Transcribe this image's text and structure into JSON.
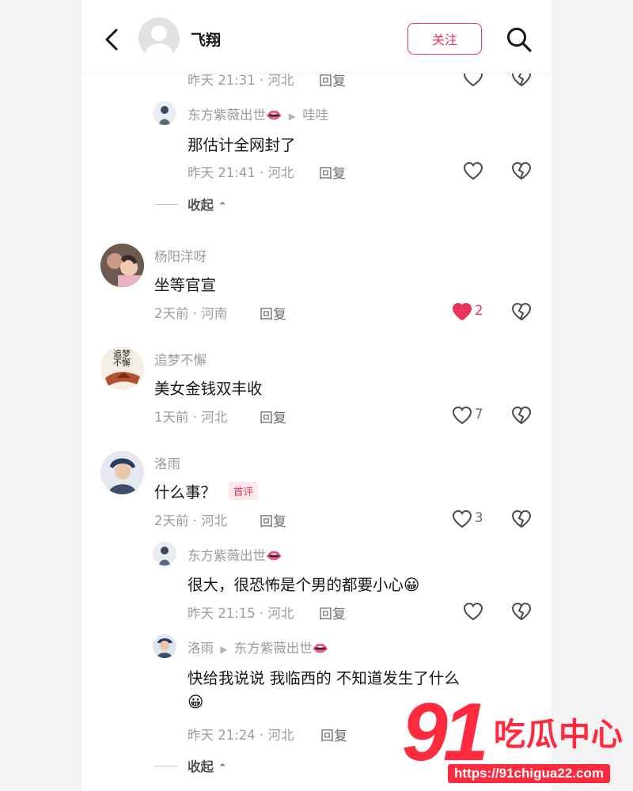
{
  "header": {
    "username": "飞翔",
    "follow_label": "关注"
  },
  "top_reply": {
    "meta": "昨天 21:31 · 河北",
    "reply_label": "回复"
  },
  "reply_a": {
    "author": "东方紫薇出世👄",
    "target": "哇哇",
    "text": "那估计全网封了",
    "meta": "昨天 21:41 · 河北",
    "reply_label": "回复"
  },
  "collapse_label": "收起",
  "comments": [
    {
      "author": "杨阳洋呀",
      "text": "坐等官宣",
      "meta": "2天前 · 河南",
      "reply_label": "回复",
      "likes": "2",
      "liked": true
    },
    {
      "author": "追梦不懈",
      "avatar_text": "追梦不懈",
      "text": "美女金钱双丰收",
      "meta": "1天前 · 河北",
      "reply_label": "回复",
      "likes": "7",
      "liked": false
    },
    {
      "author": "洛雨",
      "text": "什么事？",
      "badge": "首评",
      "meta": "2天前 · 河北",
      "reply_label": "回复",
      "likes": "3",
      "liked": false
    }
  ],
  "replies": [
    {
      "author": "东方紫薇出世👄",
      "text": "很大，很恐怖是个男的都要小心😀",
      "meta": "昨天 21:15 · 河北",
      "reply_label": "回复"
    },
    {
      "author": "洛雨",
      "target": "东方紫薇出世👄",
      "text": "快给我说说  我临西的  不知道发生了什么",
      "text_line2": "😀",
      "meta": "昨天 21:24 · 河北",
      "reply_label": "回复"
    }
  ],
  "watermark": {
    "number": "91",
    "brand": "吃瓜中心",
    "url": "https://91chigua22.com"
  },
  "colors": {
    "accent": "#e8345a",
    "watermark": "#ff2a3d"
  }
}
